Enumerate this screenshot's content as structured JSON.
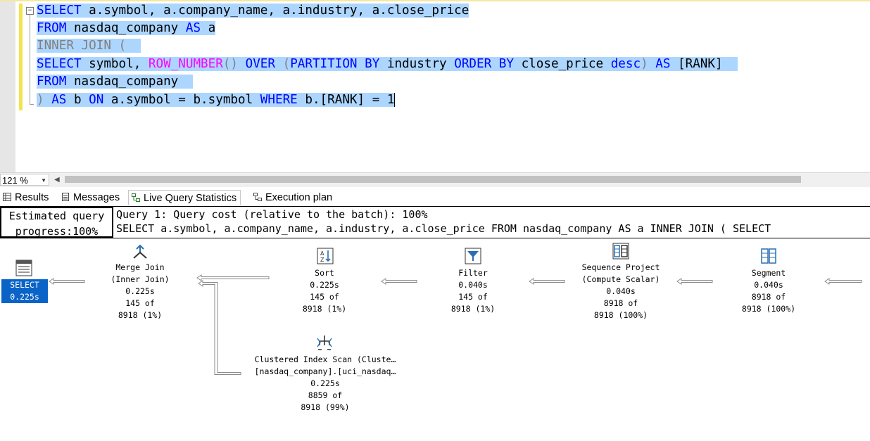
{
  "editor": {
    "fold_symbol": "−",
    "lines": {
      "l1": {
        "kw1": "SELECT",
        "rest": " a.symbol, a.company_name, a.industry, a.close_price"
      },
      "l2": {
        "kw1": "FROM",
        "rest": " nasdaq_company ",
        "kw2": "AS",
        "rest2": " a"
      },
      "l3": {
        "text": "INNER JOIN ("
      },
      "l4": {
        "kw1": "SELECT",
        "p1": " symbol, ",
        "fn": "ROW_NUMBER",
        "p2": "() ",
        "kw2": "OVER",
        "p3": " (",
        "kw3": "PARTITION BY",
        "p4": " industry ",
        "kw4": "ORDER BY",
        "p5": " close_price ",
        "kw5": "desc",
        "p6": ") ",
        "kw6": "AS",
        "p7": " [RANK]"
      },
      "l5": {
        "kw1": "FROM",
        "rest": " nasdaq_company"
      },
      "l6": {
        "p1": ") ",
        "kw1": "AS",
        "p2": " b ",
        "kw2": "ON",
        "p3": " a.symbol = b.symbol ",
        "kw3": "WHERE",
        "p4": " b.[RANK] = 1"
      }
    }
  },
  "zoom": {
    "value": "121 %"
  },
  "tabs": [
    "Results",
    "Messages",
    "Live Query Statistics",
    "Execution plan"
  ],
  "info": {
    "progress_line1": "Estimated query",
    "progress_line2": "progress:100%",
    "query_cost": "Query 1: Query cost (relative to the batch): 100%",
    "query_text": "SELECT a.symbol, a.company_name, a.industry, a.close_price FROM nasdaq_company AS a INNER JOIN ( SELECT"
  },
  "plan": {
    "select": {
      "name": "SELECT",
      "time": "0.225s"
    },
    "merge_join": {
      "l1": "Merge Join",
      "l2": "(Inner Join)",
      "l3": "0.225s",
      "l4": "145 of",
      "l5": "8918 (1%)"
    },
    "sort": {
      "l1": "Sort",
      "l2": "0.225s",
      "l3": "145 of",
      "l4": "8918 (1%)"
    },
    "filter": {
      "l1": "Filter",
      "l2": "0.040s",
      "l3": "145 of",
      "l4": "8918 (1%)"
    },
    "seq_project": {
      "l1": "Sequence Project",
      "l2": "(Compute Scalar)",
      "l3": "0.040s",
      "l4": "8918 of",
      "l5": "8918 (100%)"
    },
    "segment": {
      "l1": "Segment",
      "l2": "0.040s",
      "l3": "8918 of",
      "l4": "8918 (100%)"
    },
    "index_scan": {
      "l1": "Clustered Index Scan (Cluste…",
      "l2": "[nasdaq_company].[uci_nasdaq…",
      "l3": "0.225s",
      "l4": "8859 of",
      "l5": "8918 (99%)"
    }
  },
  "colors": {
    "selection": "#add6ff",
    "keyword": "#0000ff",
    "function": "#ff00ff",
    "gray": "#808080",
    "select_highlight": "#0a64c8"
  }
}
